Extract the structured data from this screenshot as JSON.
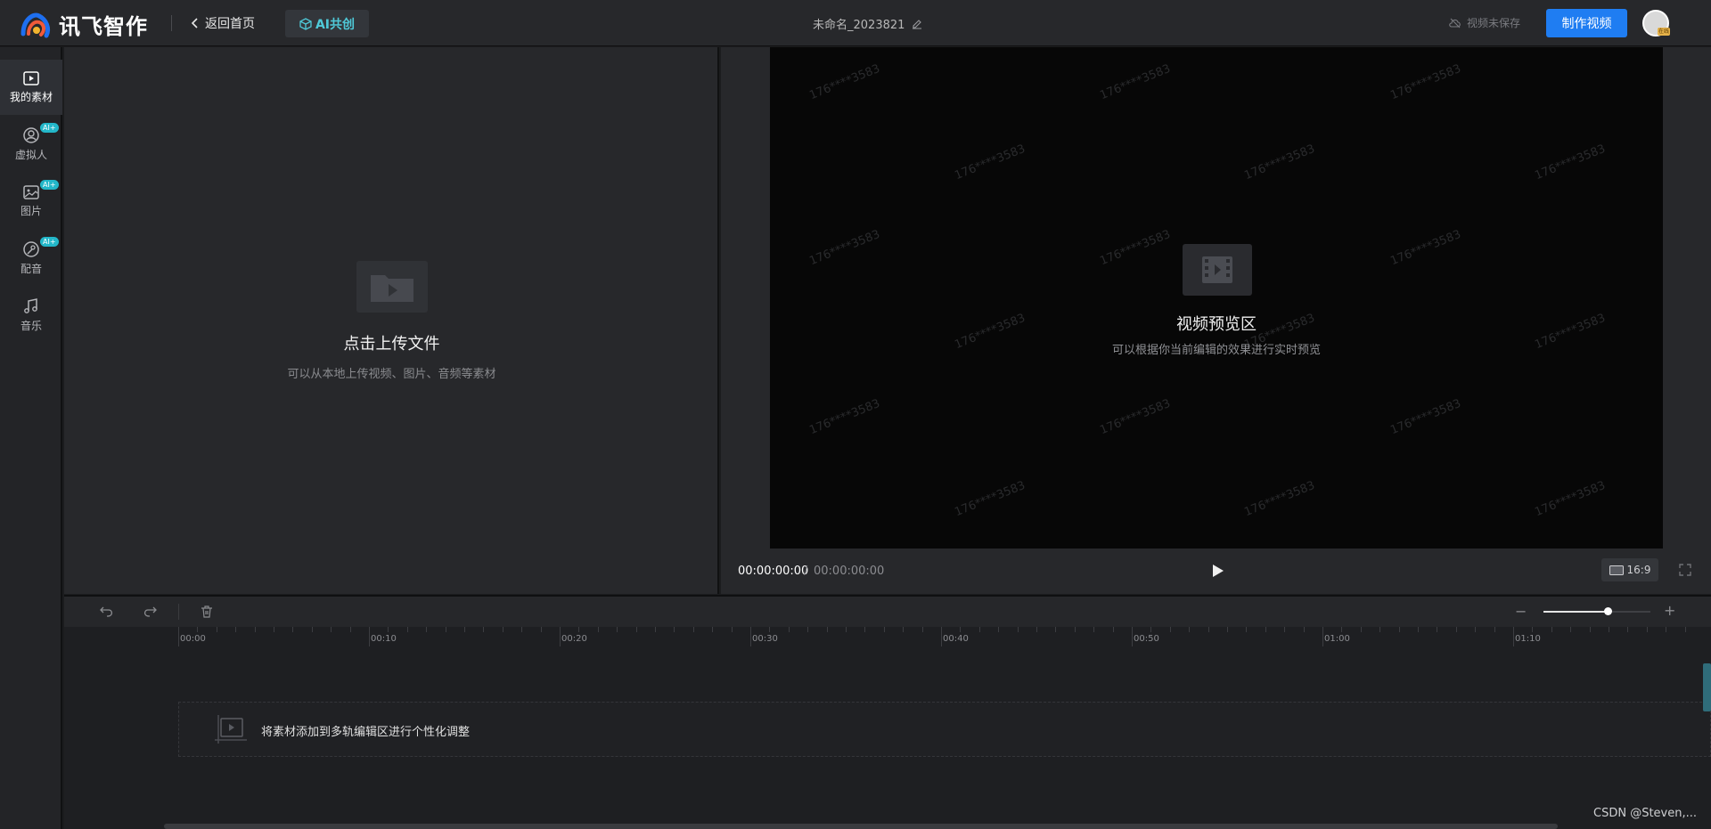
{
  "header": {
    "logo_text": "讯飞智作",
    "back_label": "返回首页",
    "ai_label": "AI共创",
    "project_title": "未命名_2023821",
    "save_status": "视频未保存",
    "make_video_label": "制作视频",
    "avatar_badge": "在线"
  },
  "sidebar": {
    "items": [
      {
        "label": "我的素材",
        "icon": "play-square-icon",
        "ai": false
      },
      {
        "label": "虚拟人",
        "icon": "avatar-icon",
        "ai": true
      },
      {
        "label": "图片",
        "icon": "image-icon",
        "ai": true
      },
      {
        "label": "配音",
        "icon": "voice-icon",
        "ai": true
      },
      {
        "label": "音乐",
        "icon": "music-icon",
        "ai": false
      }
    ],
    "ai_tag": "AI+"
  },
  "material": {
    "title": "点击上传文件",
    "subtitle": "可以从本地上传视频、图片、音频等素材"
  },
  "preview": {
    "title": "视频预览区",
    "subtitle": "可以根据你当前编辑的效果进行实时预览",
    "watermark": "176****3583",
    "current_time": "00:00:00:00",
    "separator": "/",
    "total_time": "00:00:00:00",
    "ratio": "16:9"
  },
  "timeline": {
    "ticks": [
      "00:00",
      "00:10",
      "00:20",
      "00:30",
      "00:40",
      "00:50",
      "01:00",
      "01:10"
    ],
    "drop_hint": "将素材添加到多轨编辑区进行个性化调整",
    "zoom_level": 0.6
  },
  "footer": {
    "credit": "CSDN @Steven,..."
  },
  "colors": {
    "accent": "#1f7df2",
    "ai_tag": "#23b7c9",
    "ai_text": "#4fc9d8"
  }
}
